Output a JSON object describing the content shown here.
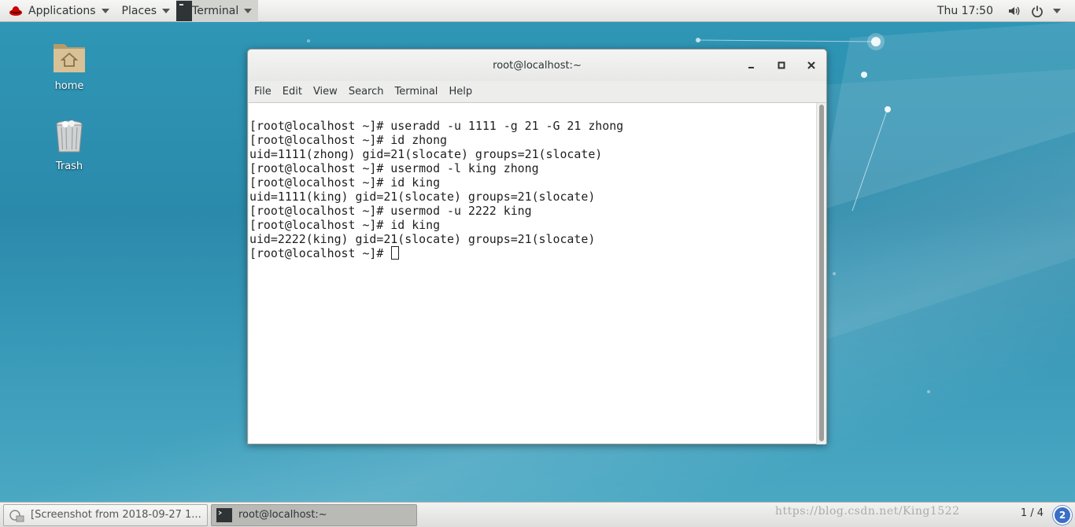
{
  "topbar": {
    "applications_label": "Applications",
    "places_label": "Places",
    "terminal_label": "Terminal",
    "clock": "Thu 17:50"
  },
  "desktop": {
    "icons": [
      {
        "label": "home",
        "icon": "home-folder-icon"
      },
      {
        "label": "Trash",
        "icon": "trash-icon"
      }
    ]
  },
  "window": {
    "title": "root@localhost:~",
    "menu": [
      "File",
      "Edit",
      "View",
      "Search",
      "Terminal",
      "Help"
    ],
    "lines": [
      "[root@localhost ~]# useradd -u 1111 -g 21 -G 21 zhong",
      "[root@localhost ~]# id zhong",
      "uid=1111(zhong) gid=21(slocate) groups=21(slocate)",
      "[root@localhost ~]# usermod -l king zhong",
      "[root@localhost ~]# id king",
      "uid=1111(king) gid=21(slocate) groups=21(slocate)",
      "[root@localhost ~]# usermod -u 2222 king",
      "[root@localhost ~]# id king",
      "uid=2222(king) gid=21(slocate) groups=21(slocate)",
      "[root@localhost ~]# "
    ]
  },
  "taskbar": {
    "tasks": [
      {
        "label": "[Screenshot from 2018-09-27 1...",
        "icon": "screenshot-icon",
        "active": false
      },
      {
        "label": "root@localhost:~",
        "icon": "terminal-icon",
        "active": true
      }
    ],
    "watermark": "https://blog.csdn.net/King1522",
    "pager": "1 / 4",
    "workspace_badge": "2"
  },
  "colors": {
    "desktop": "#2b8aab",
    "topbar": "#ececea",
    "terminal_bg": "#ffffff",
    "badge": "#3b6fc6"
  }
}
